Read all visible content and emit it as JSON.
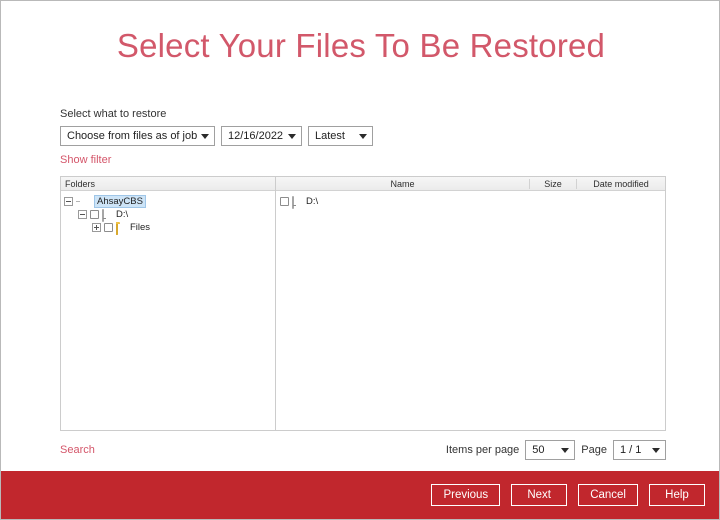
{
  "page": {
    "title": "Select Your Files To Be Restored"
  },
  "restore_form": {
    "label": "Select what to restore",
    "source_select": {
      "value": "Choose from files as of job",
      "icon": "chevron-down-icon"
    },
    "date_select": {
      "value": "12/16/2022",
      "icon": "chevron-down-icon"
    },
    "time_select": {
      "value": "Latest",
      "icon": "chevron-down-icon"
    },
    "show_filter_link": "Show filter"
  },
  "folders_panel": {
    "header": "Folders",
    "tree": [
      {
        "label": "AhsayCBS",
        "level": 1,
        "icon": "ahsay-app-icon",
        "expander": "minus",
        "checkbox": false,
        "has_checkbox": false,
        "selected": true
      },
      {
        "label": "D:\\",
        "level": 2,
        "icon": "drive-icon",
        "expander": "minus",
        "checkbox": false,
        "has_checkbox": true,
        "selected": false
      },
      {
        "label": "Files",
        "level": 3,
        "icon": "folder-icon",
        "expander": "plus",
        "checkbox": false,
        "has_checkbox": true,
        "selected": false
      }
    ]
  },
  "files_panel": {
    "columns": [
      "Name",
      "Size",
      "Date modified"
    ],
    "rows": [
      {
        "name": "D:\\",
        "size": "",
        "date_modified": "",
        "icon": "drive-icon",
        "checked": false
      }
    ]
  },
  "bottom": {
    "search_link": "Search",
    "items_per_page_label": "Items per page",
    "items_per_page_value": "50",
    "page_label": "Page",
    "page_value": "1 / 1"
  },
  "footer": {
    "previous": "Previous",
    "next": "Next",
    "cancel": "Cancel",
    "help": "Help"
  },
  "colors": {
    "title": "#d2586a",
    "footer_bar": "#c1272d",
    "link": "#d4566a"
  }
}
